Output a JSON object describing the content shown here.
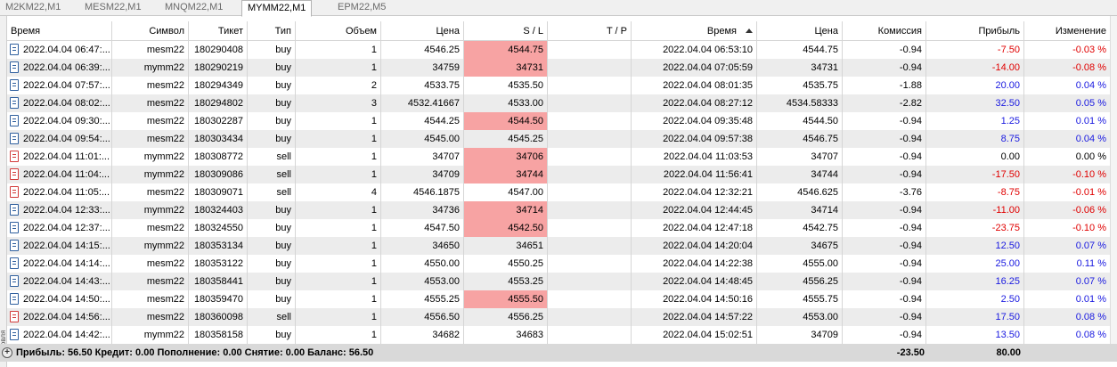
{
  "tabs": [
    "M2KM22,M1",
    "MESM22,M1",
    "MNQM22,M1",
    "MYMM22,M1",
    "EPM22,M5"
  ],
  "active_tab": 3,
  "side_label": "Торговля",
  "columns": {
    "open_time": "Время",
    "symbol": "Символ",
    "ticket": "Тикет",
    "type": "Тип",
    "volume": "Объем",
    "open_price": "Цена",
    "sl": "S / L",
    "tp": "T / P",
    "close_time": "Время",
    "close_price": "Цена",
    "commission": "Комиссия",
    "profit": "Прибыль",
    "change": "Изменение"
  },
  "rows": [
    {
      "open_time": "2022.04.04 06:47:...",
      "symbol": "mesm22",
      "ticket": "180290408",
      "type": "buy",
      "volume": "1",
      "open_price": "4546.25",
      "sl": "4544.75",
      "sl_hit": true,
      "tp": "",
      "close_time": "2022.04.04 06:53:10",
      "close_price": "4544.75",
      "commission": "-0.94",
      "profit": "-7.50",
      "change": "-0.03 %",
      "sign": "neg"
    },
    {
      "open_time": "2022.04.04 06:39:...",
      "symbol": "mymm22",
      "ticket": "180290219",
      "type": "buy",
      "volume": "1",
      "open_price": "34759",
      "sl": "34731",
      "sl_hit": true,
      "tp": "",
      "close_time": "2022.04.04 07:05:59",
      "close_price": "34731",
      "commission": "-0.94",
      "profit": "-14.00",
      "change": "-0.08 %",
      "sign": "neg"
    },
    {
      "open_time": "2022.04.04 07:57:...",
      "symbol": "mesm22",
      "ticket": "180294349",
      "type": "buy",
      "volume": "2",
      "open_price": "4533.75",
      "sl": "4535.50",
      "sl_hit": false,
      "tp": "",
      "close_time": "2022.04.04 08:01:35",
      "close_price": "4535.75",
      "commission": "-1.88",
      "profit": "20.00",
      "change": "0.04 %",
      "sign": "pos"
    },
    {
      "open_time": "2022.04.04 08:02:...",
      "symbol": "mesm22",
      "ticket": "180294802",
      "type": "buy",
      "volume": "3",
      "open_price": "4532.41667",
      "sl": "4533.00",
      "sl_hit": false,
      "tp": "",
      "close_time": "2022.04.04 08:27:12",
      "close_price": "4534.58333",
      "commission": "-2.82",
      "profit": "32.50",
      "change": "0.05 %",
      "sign": "pos"
    },
    {
      "open_time": "2022.04.04 09:30:...",
      "symbol": "mesm22",
      "ticket": "180302287",
      "type": "buy",
      "volume": "1",
      "open_price": "4544.25",
      "sl": "4544.50",
      "sl_hit": true,
      "tp": "",
      "close_time": "2022.04.04 09:35:48",
      "close_price": "4544.50",
      "commission": "-0.94",
      "profit": "1.25",
      "change": "0.01 %",
      "sign": "pos"
    },
    {
      "open_time": "2022.04.04 09:54:...",
      "symbol": "mesm22",
      "ticket": "180303434",
      "type": "buy",
      "volume": "1",
      "open_price": "4545.00",
      "sl": "4545.25",
      "sl_hit": false,
      "tp": "",
      "close_time": "2022.04.04 09:57:38",
      "close_price": "4546.75",
      "commission": "-0.94",
      "profit": "8.75",
      "change": "0.04 %",
      "sign": "pos"
    },
    {
      "open_time": "2022.04.04 11:01:...",
      "symbol": "mymm22",
      "ticket": "180308772",
      "type": "sell",
      "volume": "1",
      "open_price": "34707",
      "sl": "34706",
      "sl_hit": true,
      "tp": "",
      "close_time": "2022.04.04 11:03:53",
      "close_price": "34707",
      "commission": "-0.94",
      "profit": "0.00",
      "change": "0.00 %",
      "sign": "zero"
    },
    {
      "open_time": "2022.04.04 11:04:...",
      "symbol": "mymm22",
      "ticket": "180309086",
      "type": "sell",
      "volume": "1",
      "open_price": "34709",
      "sl": "34744",
      "sl_hit": true,
      "tp": "",
      "close_time": "2022.04.04 11:56:41",
      "close_price": "34744",
      "commission": "-0.94",
      "profit": "-17.50",
      "change": "-0.10 %",
      "sign": "neg"
    },
    {
      "open_time": "2022.04.04 11:05:...",
      "symbol": "mesm22",
      "ticket": "180309071",
      "type": "sell",
      "volume": "4",
      "open_price": "4546.1875",
      "sl": "4547.00",
      "sl_hit": false,
      "tp": "",
      "close_time": "2022.04.04 12:32:21",
      "close_price": "4546.625",
      "commission": "-3.76",
      "profit": "-8.75",
      "change": "-0.01 %",
      "sign": "neg"
    },
    {
      "open_time": "2022.04.04 12:33:...",
      "symbol": "mymm22",
      "ticket": "180324403",
      "type": "buy",
      "volume": "1",
      "open_price": "34736",
      "sl": "34714",
      "sl_hit": true,
      "tp": "",
      "close_time": "2022.04.04 12:44:45",
      "close_price": "34714",
      "commission": "-0.94",
      "profit": "-11.00",
      "change": "-0.06 %",
      "sign": "neg"
    },
    {
      "open_time": "2022.04.04 12:37:...",
      "symbol": "mesm22",
      "ticket": "180324550",
      "type": "buy",
      "volume": "1",
      "open_price": "4547.50",
      "sl": "4542.50",
      "sl_hit": true,
      "tp": "",
      "close_time": "2022.04.04 12:47:18",
      "close_price": "4542.75",
      "commission": "-0.94",
      "profit": "-23.75",
      "change": "-0.10 %",
      "sign": "neg"
    },
    {
      "open_time": "2022.04.04 14:15:...",
      "symbol": "mymm22",
      "ticket": "180353134",
      "type": "buy",
      "volume": "1",
      "open_price": "34650",
      "sl": "34651",
      "sl_hit": false,
      "tp": "",
      "close_time": "2022.04.04 14:20:04",
      "close_price": "34675",
      "commission": "-0.94",
      "profit": "12.50",
      "change": "0.07 %",
      "sign": "pos"
    },
    {
      "open_time": "2022.04.04 14:14:...",
      "symbol": "mesm22",
      "ticket": "180353122",
      "type": "buy",
      "volume": "1",
      "open_price": "4550.00",
      "sl": "4550.25",
      "sl_hit": false,
      "tp": "",
      "close_time": "2022.04.04 14:22:38",
      "close_price": "4555.00",
      "commission": "-0.94",
      "profit": "25.00",
      "change": "0.11 %",
      "sign": "pos"
    },
    {
      "open_time": "2022.04.04 14:43:...",
      "symbol": "mesm22",
      "ticket": "180358441",
      "type": "buy",
      "volume": "1",
      "open_price": "4553.00",
      "sl": "4553.25",
      "sl_hit": false,
      "tp": "",
      "close_time": "2022.04.04 14:48:45",
      "close_price": "4556.25",
      "commission": "-0.94",
      "profit": "16.25",
      "change": "0.07 %",
      "sign": "pos"
    },
    {
      "open_time": "2022.04.04 14:50:...",
      "symbol": "mesm22",
      "ticket": "180359470",
      "type": "buy",
      "volume": "1",
      "open_price": "4555.25",
      "sl": "4555.50",
      "sl_hit": true,
      "tp": "",
      "close_time": "2022.04.04 14:50:16",
      "close_price": "4555.75",
      "commission": "-0.94",
      "profit": "2.50",
      "change": "0.01 %",
      "sign": "pos"
    },
    {
      "open_time": "2022.04.04 14:56:...",
      "symbol": "mesm22",
      "ticket": "180360098",
      "type": "sell",
      "volume": "1",
      "open_price": "4556.50",
      "sl": "4556.25",
      "sl_hit": false,
      "tp": "",
      "close_time": "2022.04.04 14:57:22",
      "close_price": "4553.00",
      "commission": "-0.94",
      "profit": "17.50",
      "change": "0.08 %",
      "sign": "pos"
    },
    {
      "open_time": "2022.04.04 14:42:...",
      "symbol": "mymm22",
      "ticket": "180358158",
      "type": "buy",
      "volume": "1",
      "open_price": "34682",
      "sl": "34683",
      "sl_hit": false,
      "tp": "",
      "close_time": "2022.04.04 15:02:51",
      "close_price": "34709",
      "commission": "-0.94",
      "profit": "13.50",
      "change": "0.08 %",
      "sign": "pos"
    }
  ],
  "summary": {
    "text": "Прибыль: 56.50  Кредит: 0.00  Пополнение: 0.00  Снятие: 0.00  Баланс: 56.50",
    "commission_total": "-23.50",
    "profit_total": "80.00"
  },
  "colors": {
    "sl_highlight": "#f7a3a3",
    "negative": "#e00000",
    "positive": "#1a1ae0",
    "alt_row": "#ececec"
  }
}
